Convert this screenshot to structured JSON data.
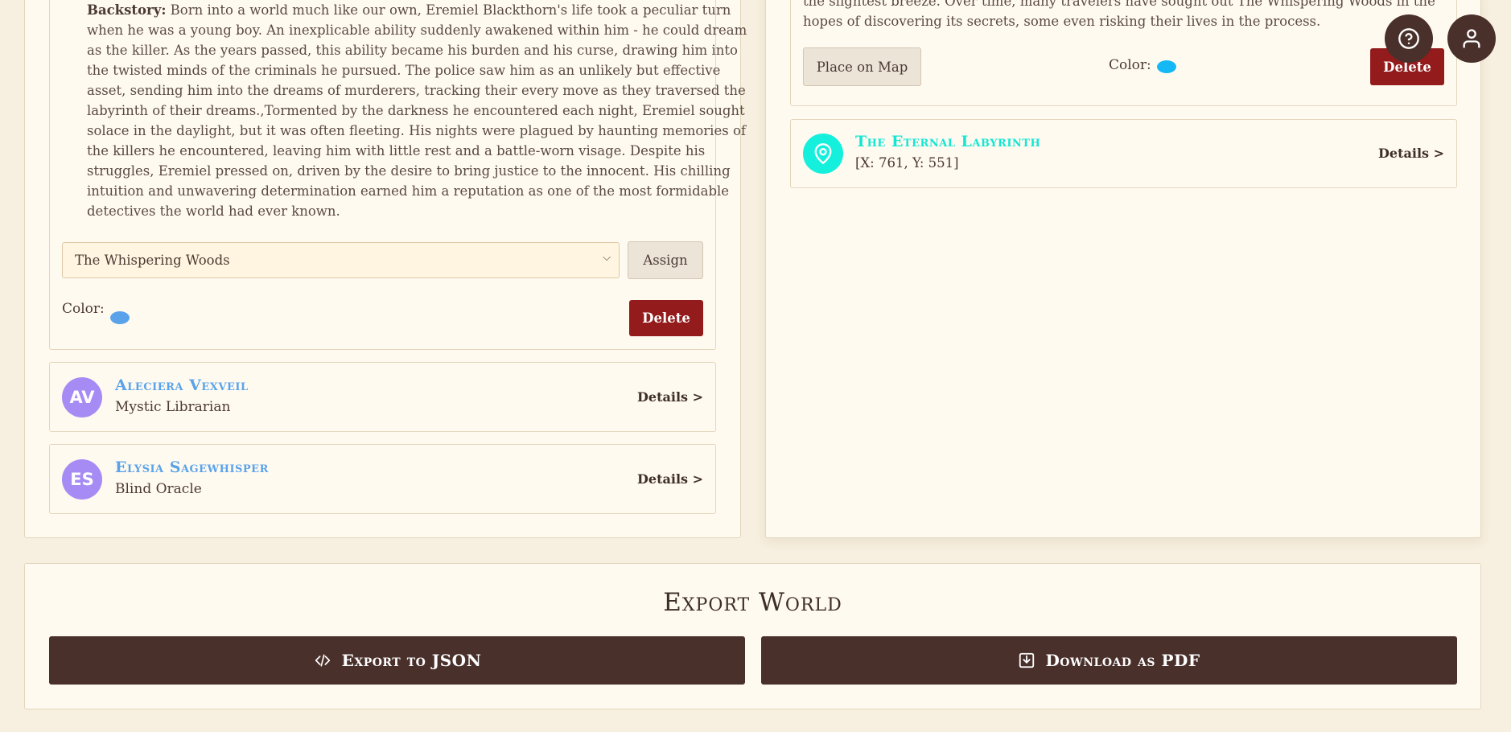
{
  "left": {
    "backstory_label": "Backstory:",
    "backstory_text": "Born into a world much like our own, Eremiel Blackthorn's life took a peculiar turn when he was a young boy. An inexplicable ability suddenly awakened within him - he could dream as the killer. As the years passed, this ability became his burden and his curse, drawing him into the twisted minds of the criminals he pursued. The police saw him as an unlikely but effective asset, sending him into the dreams of murderers, tracking their every move as they traversed the labyrinth of their dreams.,Tormented by the darkness he encountered each night, Eremiel sought solace in the daylight, but it was often fleeting. His nights were plagued by haunting memories of the killers he encountered, leaving him with little rest and a battle-worn visage. Despite his struggles, Eremiel pressed on, driven by the desire to bring justice to the innocent. His chilling intuition and unwavering determination earned him a reputation as one of the most formidable detectives the world had ever known.",
    "location_select_value": "The Whispering Woods",
    "assign_label": "Assign",
    "color_label": "Color:",
    "color_value": "#5aa3ea",
    "delete_label": "Delete",
    "characters": [
      {
        "initials": "AV",
        "name": "Aleciera Vexveil",
        "role": "Mystic Librarian",
        "details": "Details >"
      },
      {
        "initials": "ES",
        "name": "Elysia Sagewhisper",
        "role": "Blind Oracle",
        "details": "Details >"
      }
    ]
  },
  "right": {
    "description_tail": "the slightest breeze. Over time, many travelers have sought out The Whispering Woods in the hopes of discovering its secrets, some even risking their lives in the process.",
    "place_on_map_label": "Place on Map",
    "color_label": "Color:",
    "color_value": "#14b8f5",
    "delete_label": "Delete",
    "location": {
      "name": "The Eternal Labyrinth",
      "coords": "[X: 761, Y: 551]",
      "details": "Details >",
      "color": "#14f0dc"
    }
  },
  "fab": {
    "help_icon": "help-circle-icon",
    "user_icon": "user-icon"
  },
  "export": {
    "title": "Export World",
    "json_label": "Export to JSON",
    "pdf_label": "Download as PDF"
  },
  "colors": {
    "accent_dark": "#4a302b",
    "delete_red": "#931b1b",
    "avatar_purple": "#a78bf4",
    "background": "#f7efdf"
  }
}
